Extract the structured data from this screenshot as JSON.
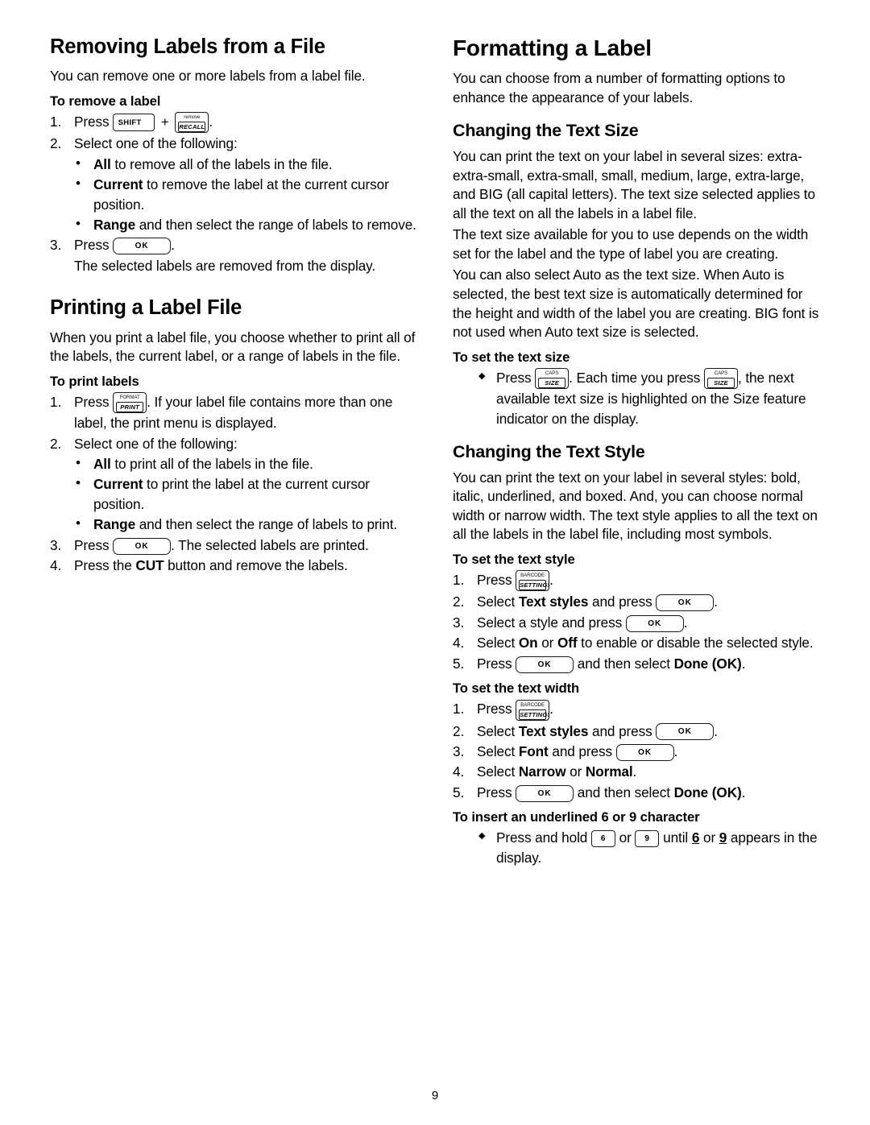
{
  "page": {
    "number": "9"
  },
  "left_column": {
    "section1": {
      "title": "Removing Labels from a File",
      "intro": "You can remove one or more labels from a label file.",
      "procedure_title": "To remove a label",
      "step1_prefix": "Press",
      "step1_suffix": ".",
      "step2": "Select one of the following:",
      "bullets": [
        {
          "bold": "All",
          "rest": " to remove all of the labels in the file."
        },
        {
          "bold": "Current",
          "rest": " to remove the label at the current cursor position."
        },
        {
          "bold": "Range",
          "rest": " and then select the range of labels to remove."
        }
      ],
      "step3_prefix": "Press",
      "step3_suffix": ".",
      "step3_note": "The selected labels are removed from the display."
    },
    "section2": {
      "title": "Printing a Label File",
      "intro": "When you print a label file, you choose whether to print all of the labels, the current label, or a range of labels in the file.",
      "procedure_title": "To print labels",
      "step1_prefix": "Press",
      "step1_suffix": ". If your label file contains more than one label, the print menu is displayed.",
      "step2": "Select one of the following:",
      "bullets": [
        {
          "bold": "All",
          "rest": " to print all of the labels in the file."
        },
        {
          "bold": "Current",
          "rest": " to print the label at the current cursor position."
        },
        {
          "bold": "Range",
          "rest": " and then select the range of labels to print."
        }
      ],
      "step3_prefix": "Press",
      "step3_suffix": ". The selected labels are printed.",
      "step4_a": "Press the ",
      "step4_bold": "CUT",
      "step4_b": " button and remove the labels."
    }
  },
  "right_column": {
    "section1": {
      "title": "Formatting a Label",
      "intro": "You can choose from a number of formatting options to enhance the appearance of your labels."
    },
    "section2": {
      "title": "Changing the Text Size",
      "para1": "You can print the text on your label in several sizes: extra-extra-small, extra-small, small, medium, large, extra-large, and BIG (all capital letters). The text size selected applies to all the text on all the labels in a label file.",
      "para2": "The text size available for you to use depends on the width set for the label and the type of label you are creating.",
      "para3": "You can also select Auto as the text size. When Auto is selected, the best text size is automatically determined for the height and width of the label you are creating. BIG font is not used when Auto text size is selected.",
      "procedure_title": "To set the text size",
      "bullet_a": "Press",
      "bullet_b": ". Each time you press",
      "bullet_c": ", the next available text size is highlighted on the Size feature indicator on the display."
    },
    "section3": {
      "title": "Changing the Text Style",
      "para1": "You can print the text on your label in several styles: bold, italic, underlined, and boxed. And, you can choose normal width or narrow width. The text style applies to all the text on all the labels in the label file, including most symbols.",
      "style_procedure_title": "To set the text style",
      "style_step1_prefix": "Press",
      "style_step1_suffix": ".",
      "style_step2_a": "Select ",
      "style_step2_bold": "Text styles",
      "style_step2_b": " and press",
      "style_step2_c": ".",
      "style_step3_a": "Select a style and press",
      "style_step3_c": ".",
      "style_step4_a": "Select ",
      "style_step4_bold1": "On",
      "style_step4_mid": " or ",
      "style_step4_bold2": "Off",
      "style_step4_b": " to enable or disable the selected style.",
      "style_step5_a": "Press",
      "style_step5_b": " and then select ",
      "style_step5_bold": "Done (OK)",
      "style_step5_c": ".",
      "width_procedure_title": "To set the text width",
      "width_step1_prefix": "Press",
      "width_step1_suffix": ".",
      "width_step2_a": "Select ",
      "width_step2_bold": "Text styles",
      "width_step2_b": " and press",
      "width_step2_c": ".",
      "width_step3_a": "Select ",
      "width_step3_bold": "Font",
      "width_step3_b": " and press",
      "width_step3_c": ".",
      "width_step4_a": "Select ",
      "width_step4_bold1": "Narrow",
      "width_step4_mid": " or ",
      "width_step4_bold2": "Normal",
      "width_step4_end": ".",
      "width_step5_a": "Press",
      "width_step5_b": " and then select ",
      "width_step5_bold": "Done (OK)",
      "width_step5_c": ".",
      "underline_procedure_title": "To insert an underlined 6 or 9 character",
      "underline_a": "Press and hold",
      "underline_or": "or",
      "underline_b": "until",
      "underline_six": "6",
      "underline_mid": "or",
      "underline_nine": "9",
      "underline_c": "appears in the display."
    }
  },
  "keys": {
    "shift": {
      "label": "SHIFT",
      "icon": "arrow-up-icon"
    },
    "recall": {
      "top": "remove",
      "bottom": "RECALL"
    },
    "ok": {
      "label": "OK"
    },
    "print": {
      "top": "FORMAT",
      "bottom": "PRINT"
    },
    "size": {
      "top": "CAPS",
      "bottom": "SIZE"
    },
    "settings": {
      "top": "BARCODE",
      "bottom": "SETTINGS"
    },
    "six": {
      "label": "6"
    },
    "nine": {
      "label": "9"
    }
  }
}
